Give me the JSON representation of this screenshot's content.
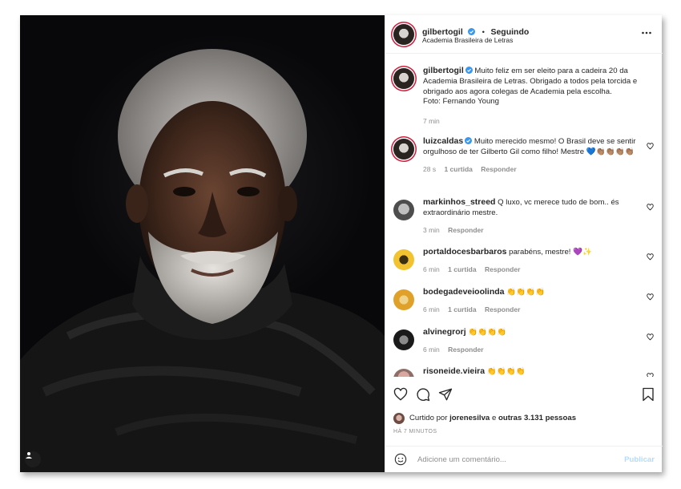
{
  "header": {
    "username": "gilbertogil",
    "separator": "•",
    "follow_status": "Seguindo",
    "location": "Academia Brasileira de Letras",
    "more_icon": "more-horizontal-icon"
  },
  "caption": {
    "username": "gilbertogil",
    "text": "Muito feliz em ser eleito para a cadeira 20 da Academia Brasileira de Letras. Obrigado a todos pela torcida e obrigado aos agora colegas de Academia pela escolha.",
    "credit": "Foto: Fernando Young",
    "time": "7 min"
  },
  "comments": [
    {
      "username": "luizcaldas",
      "verified": true,
      "text": "Muito merecido mesmo! O Brasil deve se sentir orgulhoso de ter Gilberto Gil como filho! Mestre 💙👏🏽👏🏽👏🏽👏🏽",
      "time": "28 s",
      "likes": "1 curtida",
      "reply": "Responder"
    },
    {
      "username": "markinhos_streed",
      "verified": false,
      "text": "Q luxo, vc merece tudo de bom.. és extraordinário mestre.",
      "time": "3 min",
      "likes": "",
      "reply": "Responder"
    },
    {
      "username": "portaldocesbarbaros",
      "verified": false,
      "text": "parabéns, mestre! 💜✨",
      "time": "6 min",
      "likes": "1 curtida",
      "reply": "Responder"
    },
    {
      "username": "bodegadeveioolinda",
      "verified": false,
      "text": "👏👏👏👏",
      "time": "6 min",
      "likes": "1 curtida",
      "reply": "Responder"
    },
    {
      "username": "alvinegrorj",
      "verified": false,
      "text": "👏👏👏👏",
      "time": "6 min",
      "likes": "",
      "reply": "Responder"
    },
    {
      "username": "risoneide.vieira",
      "verified": false,
      "text": "👏👏👏👏",
      "time": "",
      "likes": "",
      "reply": ""
    }
  ],
  "actions": {
    "like_icon": "heart-icon",
    "comment_icon": "comment-icon",
    "share_icon": "paper-plane-icon",
    "save_icon": "bookmark-icon"
  },
  "likes": {
    "prefix": "Curtido por",
    "user": "jorenesilva",
    "connector": "e",
    "others": "outras 3.131 pessoas"
  },
  "timeago": "HÁ 7 MINUTOS",
  "composer": {
    "placeholder": "Adicione um comentário...",
    "publish": "Publicar"
  },
  "colors": {
    "verified": "#3897f0",
    "story_ring": "#d01c3c",
    "publish_disabled": "#b3dbff"
  }
}
